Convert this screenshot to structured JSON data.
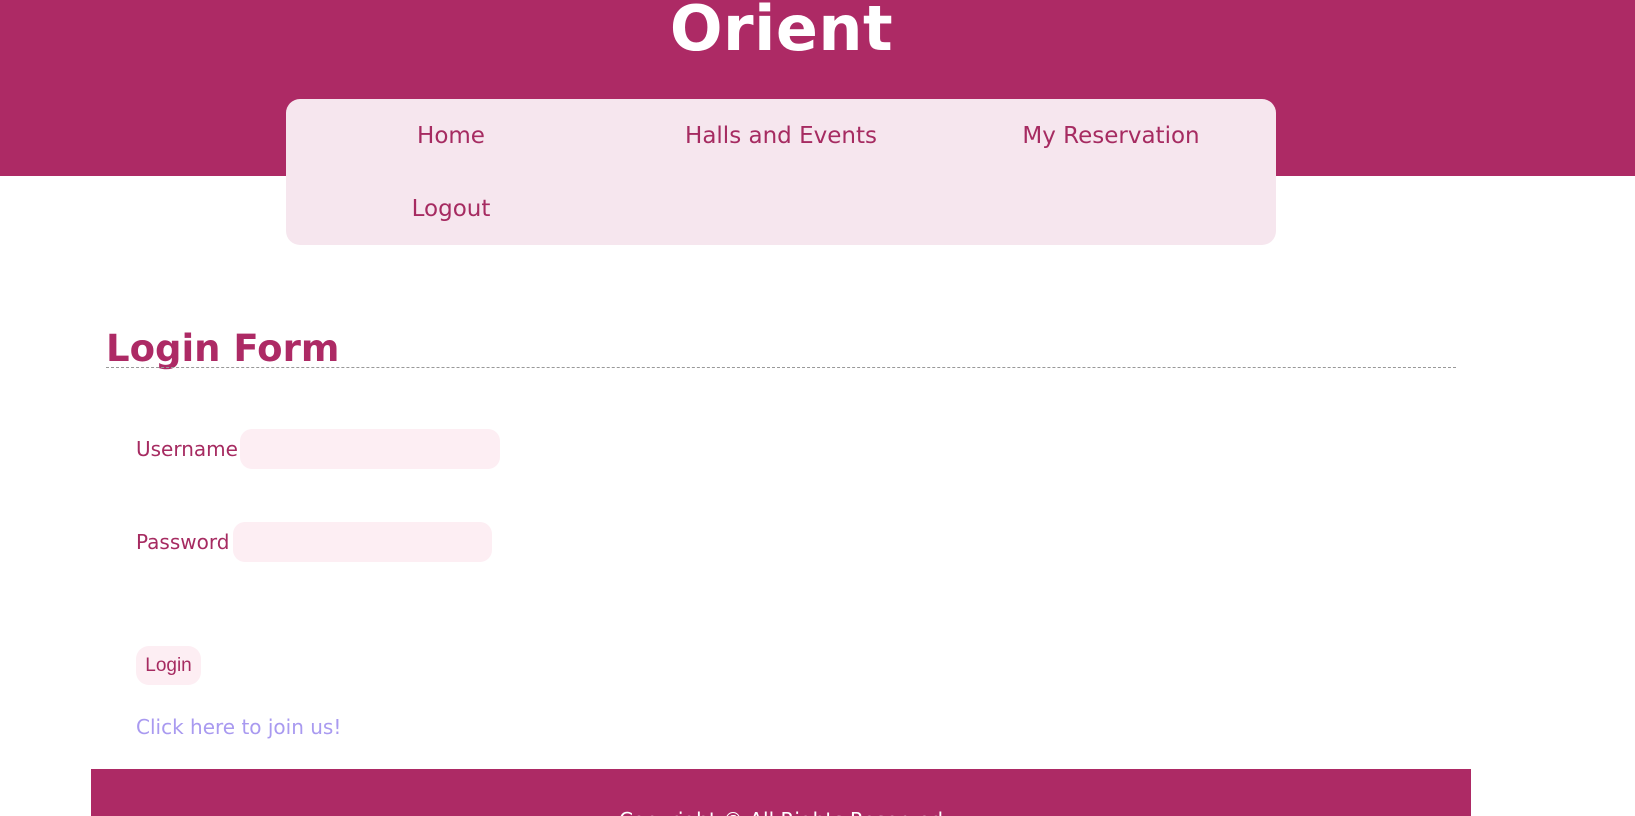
{
  "site": {
    "title": "Orient"
  },
  "nav": {
    "items": [
      {
        "label": "Home"
      },
      {
        "label": "Halls and Events"
      },
      {
        "label": "My Reservation"
      },
      {
        "label": "Logout"
      }
    ]
  },
  "form": {
    "title": "Login Form",
    "username": {
      "label": "Username",
      "value": "",
      "placeholder": ""
    },
    "password": {
      "label": "Password",
      "value": "",
      "placeholder": ""
    },
    "submit_label": "Login",
    "join_link": "Click here to join us!"
  },
  "footer": {
    "text": "Copyright © All Rights Reserved"
  },
  "colors": {
    "brand": "#ad2a65",
    "nav_background": "#f6e6ee",
    "input_background": "#fdeef3",
    "link": "#a99af0"
  }
}
